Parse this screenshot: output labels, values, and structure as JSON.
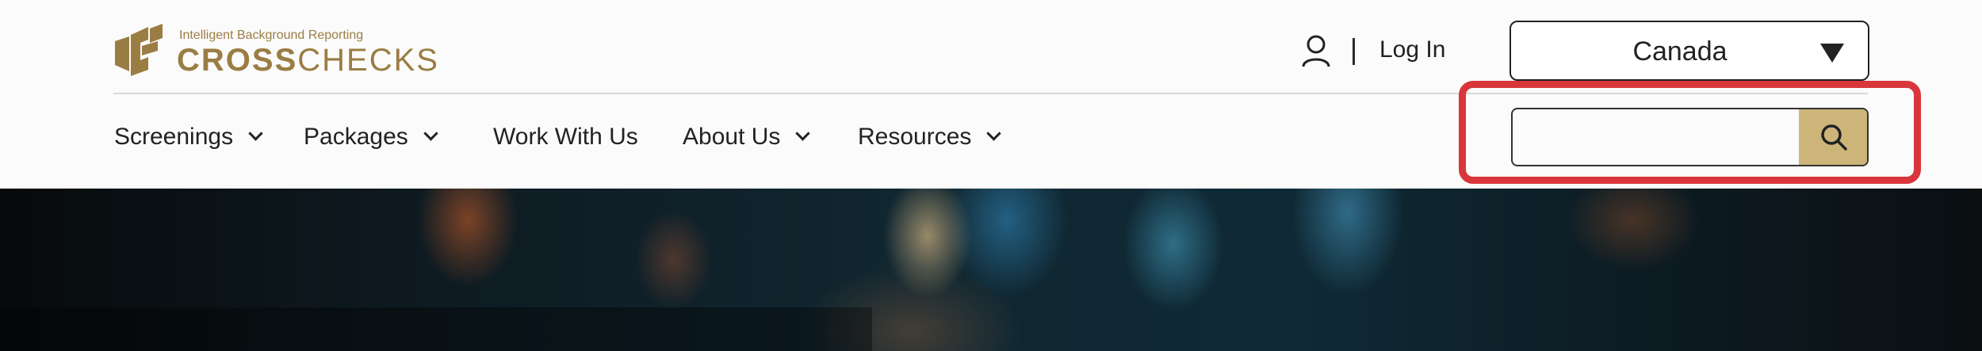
{
  "brand": {
    "tagline": "Intelligent Background Reporting",
    "name_bold": "CROSS",
    "name_light": "CHECKS",
    "color": "#9a7d43"
  },
  "header": {
    "user_icon": "user-icon",
    "login_label": "Log In",
    "country_select": {
      "value": "Canada",
      "caret_icon": "triangle-down-icon"
    }
  },
  "nav": {
    "items": [
      {
        "label": "Screenings",
        "has_dropdown": true
      },
      {
        "label": "Packages",
        "has_dropdown": true
      },
      {
        "label": "Work With Us",
        "has_dropdown": false
      },
      {
        "label": "About Us",
        "has_dropdown": true
      },
      {
        "label": "Resources",
        "has_dropdown": true
      }
    ]
  },
  "search": {
    "value": "",
    "placeholder": "",
    "button_icon": "search-icon",
    "button_color": "#cdb57a",
    "highlight_color": "#d9363b"
  }
}
